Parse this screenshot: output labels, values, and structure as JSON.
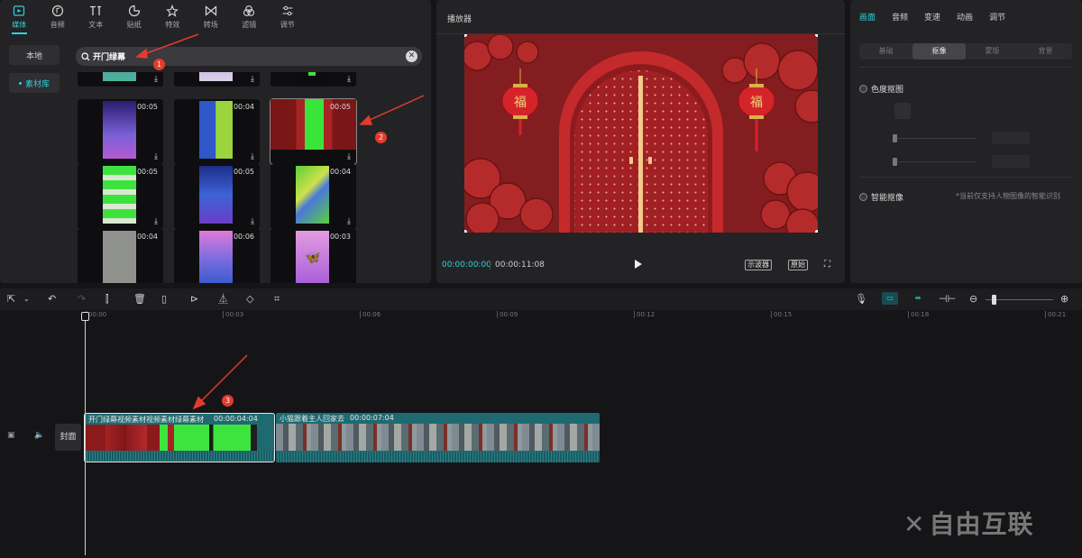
{
  "media_tabs": [
    {
      "label": "媒体",
      "icon": "media-icon"
    },
    {
      "label": "音频",
      "icon": "audio-icon"
    },
    {
      "label": "文本",
      "icon": "text-icon"
    },
    {
      "label": "贴纸",
      "icon": "sticker-icon"
    },
    {
      "label": "特效",
      "icon": "effects-icon"
    },
    {
      "label": "转场",
      "icon": "transition-icon"
    },
    {
      "label": "滤镜",
      "icon": "filter-icon"
    },
    {
      "label": "调节",
      "icon": "adjust-icon"
    }
  ],
  "sidebar": {
    "local": "本地",
    "library": "素材库"
  },
  "search": {
    "value": "开门绿幕"
  },
  "assets": [
    {
      "duration": "00:05"
    },
    {
      "duration": "00:04"
    },
    {
      "duration": "00:05"
    },
    {
      "duration": "00:05"
    },
    {
      "duration": "00:05"
    },
    {
      "duration": "00:04"
    },
    {
      "duration": "00:04"
    },
    {
      "duration": "00:06"
    },
    {
      "duration": "00:03"
    }
  ],
  "player": {
    "title": "播放器",
    "current_time": "00:00:00:00",
    "total_time": "00:00:11:08",
    "scope_label": "示波器",
    "original_label": "原始"
  },
  "props": {
    "tabs": [
      "画面",
      "音频",
      "变速",
      "动画",
      "调节"
    ],
    "subtabs": [
      "基础",
      "抠像",
      "蒙版",
      "背景"
    ],
    "chroma_key": "色度抠图",
    "smart_cutout": "智能抠像",
    "hint": "*当前仅支持人物图像的智能识别"
  },
  "ruler": [
    "00:00",
    "00:03",
    "00:06",
    "00:09",
    "00:12",
    "00:15",
    "00:18",
    "00:21"
  ],
  "track": {
    "cover": "封面"
  },
  "clips": [
    {
      "name": "开门绿幕视频素材视频素材绿幕素材",
      "duration": "00:00:04:04"
    },
    {
      "name": "小猫跟着主人回家去",
      "duration": "00:00:07:04"
    }
  ],
  "markers": [
    "1",
    "2",
    "3"
  ],
  "watermark": "自由互联",
  "colors": {
    "accent": "#2fd3d8",
    "marker": "#e23b2e",
    "clip": "#1e6a70"
  }
}
